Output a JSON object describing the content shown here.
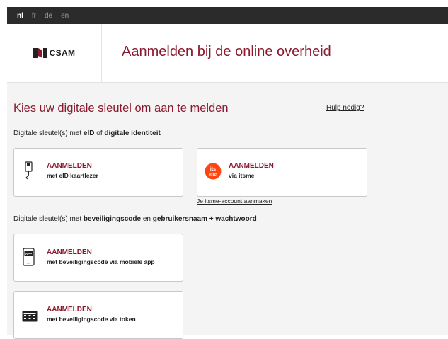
{
  "languages": [
    {
      "code": "nl",
      "active": true
    },
    {
      "code": "fr",
      "active": false
    },
    {
      "code": "de",
      "active": false
    },
    {
      "code": "en",
      "active": false
    }
  ],
  "header": {
    "logo_text": "CSAM",
    "title": "Aanmelden bij de online overheid"
  },
  "main": {
    "heading": "Kies uw digitale sleutel om aan te melden",
    "help_link": "Hulp nodig?",
    "section1": {
      "prefix": "Digitale sleutel(s) met ",
      "bold1": "eID",
      "mid": " of ",
      "bold2": "digitale identiteit"
    },
    "eid_card": {
      "title": "AANMELDEN",
      "subtitle": "met eID kaartlezer"
    },
    "itsme_card": {
      "title": "AANMELDEN",
      "subtitle": "via itsme",
      "logo_text": "its me"
    },
    "itsme_account_link": "Je itsme-account aanmaken",
    "section2": {
      "prefix": "Digitale sleutel(s) met ",
      "bold1": "beveiligingscode",
      "mid": " en ",
      "bold2": "gebruikersnaam + wachtwoord"
    },
    "app_card": {
      "title": "AANMELDEN",
      "subtitle": "met beveiligingscode via mobiele app",
      "icon_label": "APP"
    },
    "token_card": {
      "title": "AANMELDEN",
      "subtitle": "met beveiligingscode via token"
    }
  },
  "colors": {
    "brand": "#8b1a2f",
    "itsme": "#ff4612",
    "lang_bar": "#2b2b2b",
    "content_bg": "#f4f4f4"
  },
  "icons": [
    "csam-logo-icon",
    "eid-card-reader-icon",
    "itsme-logo-icon",
    "mobile-app-icon",
    "token-icon"
  ]
}
